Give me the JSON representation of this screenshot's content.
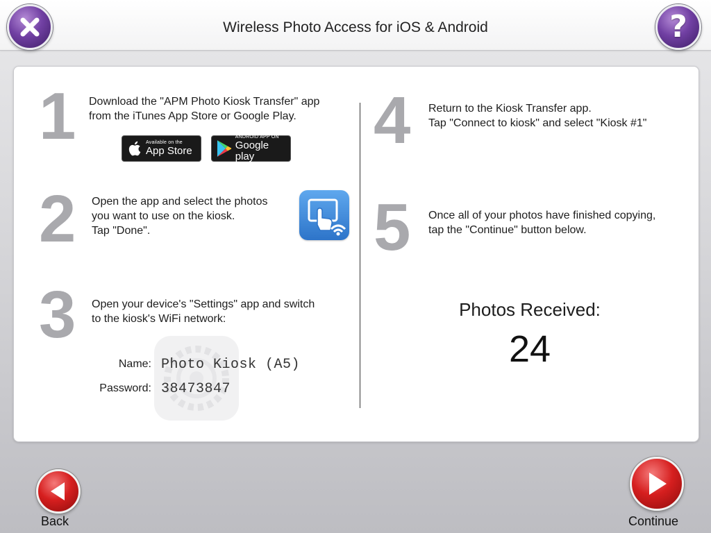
{
  "header": {
    "title": "Wireless Photo Access for iOS & Android",
    "close_icon": "close-x-icon",
    "help_icon": "question-mark-icon",
    "help_glyph": "?"
  },
  "steps": {
    "step1": {
      "number": "1",
      "line1": "Download the \"APM Photo Kiosk Transfer\" app",
      "line2": "from the iTunes App Store or Google Play.",
      "appstore_small": "Available on the",
      "appstore_large": "App Store",
      "googleplay_small": "ANDROID APP ON",
      "googleplay_large": "Google play"
    },
    "step2": {
      "number": "2",
      "line1": "Open the app and select the photos",
      "line2": "you want to use on the kiosk.",
      "line3": "Tap \"Done\"."
    },
    "step3": {
      "number": "3",
      "line1": "Open your device's \"Settings\" app and switch",
      "line2": "to the kiosk's WiFi network:",
      "name_label": "Name:",
      "name_value": "Photo Kiosk (A5)",
      "password_label": "Password:",
      "password_value": "38473847"
    },
    "step4": {
      "number": "4",
      "line1": "Return to the Kiosk Transfer app.",
      "line2": "Tap \"Connect to kiosk\" and select \"Kiosk #1\""
    },
    "step5": {
      "number": "5",
      "line1": "Once all of your photos have finished copying,",
      "line2": "tap the \"Continue\" button below."
    }
  },
  "received": {
    "label": "Photos Received:",
    "count": "24"
  },
  "footer": {
    "back_label": "Back",
    "continue_label": "Continue"
  },
  "colors": {
    "header_button": "#6a3a9c",
    "nav_button": "#d21c1c",
    "step_number": "#a9a9ad",
    "app_icon": "#3d86d9"
  }
}
